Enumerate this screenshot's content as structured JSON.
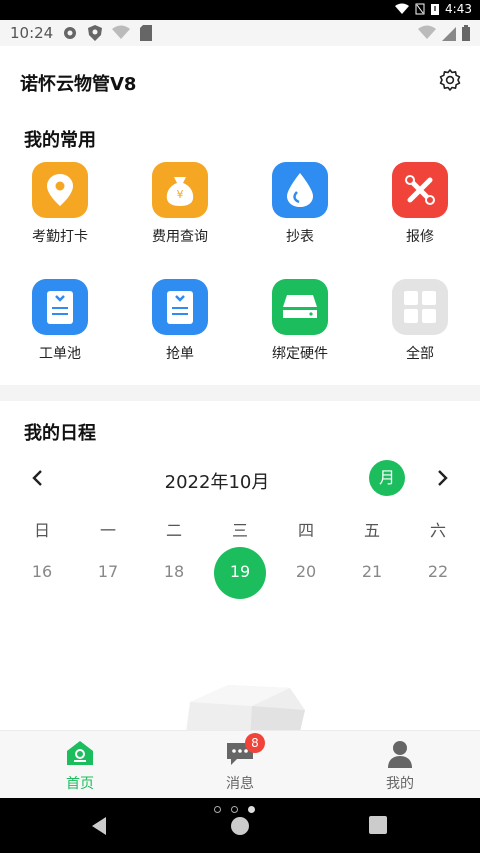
{
  "system": {
    "time": "4:43"
  },
  "app_status": {
    "time": "10:24"
  },
  "header": {
    "title": "诺怀云物管V8",
    "settings_icon": "gear-icon"
  },
  "favorites": {
    "title": "我的常用",
    "items": [
      {
        "label": "考勤打卡",
        "icon": "location-pin-icon",
        "color": "#f5a623"
      },
      {
        "label": "费用查询",
        "icon": "money-bag-icon",
        "color": "#f5a623"
      },
      {
        "label": "抄表",
        "icon": "water-drop-icon",
        "color": "#2f8cf0"
      },
      {
        "label": "报修",
        "icon": "tools-icon",
        "color": "#f0433a"
      },
      {
        "label": "工单池",
        "icon": "work-order-icon",
        "color": "#2f8cf0"
      },
      {
        "label": "抢单",
        "icon": "grab-order-icon",
        "color": "#2f8cf0"
      },
      {
        "label": "绑定硬件",
        "icon": "hardware-icon",
        "color": "#1cbd5c"
      },
      {
        "label": "全部",
        "icon": "grid-all-icon",
        "color": "#e3e3e3"
      }
    ]
  },
  "schedule": {
    "title": "我的日程",
    "month_label": "2022年10月",
    "view_button": "月",
    "weekdays": [
      "日",
      "一",
      "二",
      "三",
      "四",
      "五",
      "六"
    ],
    "days": [
      "16",
      "17",
      "18",
      "19",
      "20",
      "21",
      "22"
    ],
    "selected_day": "19"
  },
  "tabbar": {
    "items": [
      {
        "label": "首页",
        "icon": "home-icon",
        "active": true
      },
      {
        "label": "消息",
        "icon": "message-icon",
        "badge": "8"
      },
      {
        "label": "我的",
        "icon": "profile-icon"
      }
    ]
  },
  "colors": {
    "accent": "#1cbd5c",
    "badge": "#f0433a"
  }
}
